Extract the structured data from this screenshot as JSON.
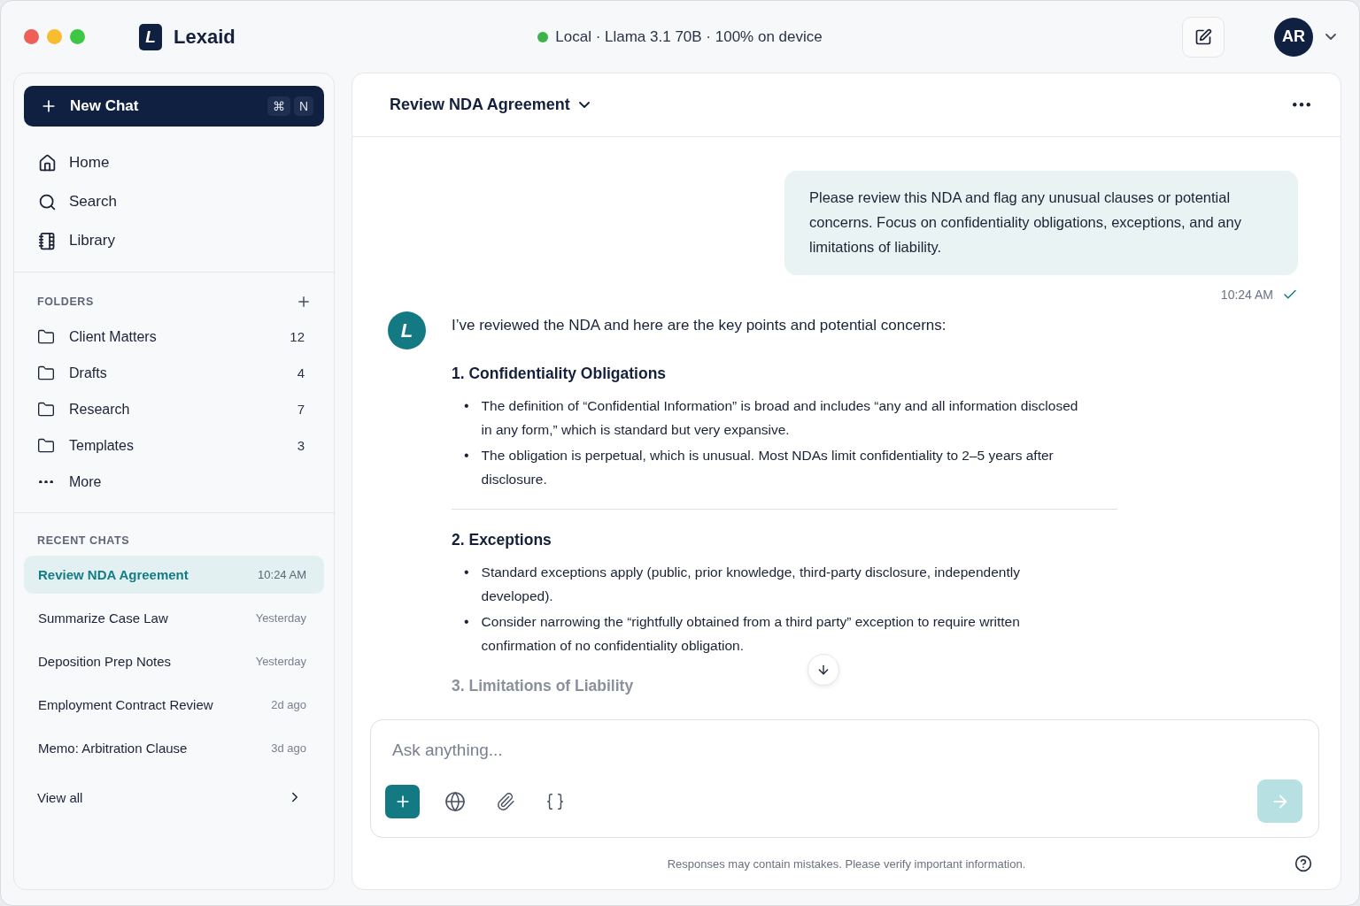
{
  "app": {
    "logo_letter": "L",
    "name": "Lexaid"
  },
  "status": {
    "online": true,
    "text": "Local · Llama 3.1 70B · 100% on device"
  },
  "user": {
    "initials": "AR"
  },
  "sidebar": {
    "new_chat": {
      "label": "New Chat",
      "keys": [
        "⌘",
        "N"
      ]
    },
    "nav": [
      {
        "kind": "home",
        "label": "Home"
      },
      {
        "kind": "search",
        "label": "Search"
      },
      {
        "kind": "library",
        "label": "Library"
      }
    ],
    "folders": {
      "title": "FOLDERS",
      "items": [
        {
          "name": "Client Matters",
          "count": "12"
        },
        {
          "name": "Drafts",
          "count": "4"
        },
        {
          "name": "Research",
          "count": "7"
        },
        {
          "name": "Templates",
          "count": "3"
        }
      ],
      "more": "More"
    },
    "recent": {
      "title": "RECENT CHATS",
      "items": [
        {
          "title": "Review NDA Agreement",
          "time": "10:24 AM",
          "selected": true
        },
        {
          "title": "Summarize Case Law",
          "time": "Yesterday",
          "selected": false
        },
        {
          "title": "Deposition Prep Notes",
          "time": "Yesterday",
          "selected": false
        },
        {
          "title": "Employment Contract Review",
          "time": "2d ago",
          "selected": false
        },
        {
          "title": "Memo: Arbitration Clause",
          "time": "3d ago",
          "selected": false
        }
      ],
      "view_all": "View all"
    }
  },
  "chat": {
    "title": "Review NDA Agreement",
    "user_message": {
      "text": "Please review this NDA and flag any unusual clauses or potential concerns. Focus on confidentiality obligations, exceptions, and any limitations of liability.",
      "time": "10:24 AM",
      "delivered": true
    },
    "reply": {
      "avatar_letter": "L",
      "intro": "I’ve reviewed the NDA and here are the key points and potential concerns:",
      "sections": [
        {
          "heading": "1. Confidentiality Obligations",
          "bullets": [
            {
              "marker": "•",
              "text": "The definition of “Confidential Information” is broad and includes “any and all information disclosed in any form,” which is standard but very expansive."
            },
            {
              "marker": "•",
              "text": "The obligation is perpetual, which is unusual. Most NDAs limit confidentiality to 2–5 years after disclosure."
            }
          ]
        },
        {
          "heading": "2. Exceptions",
          "bullets": [
            {
              "marker": "•",
              "text": "Standard exceptions apply (public, prior knowledge, third-party disclosure, independently developed)."
            },
            {
              "marker": "•",
              "text": "Consider narrowing the “rightfully obtained from a third party” exception to require written confirmation of no confidentiality obligation."
            }
          ]
        }
      ],
      "faded_heading": "3. Limitations of Liability"
    }
  },
  "composer": {
    "placeholder": "Ask anything...",
    "note": "Responses may contain mistakes. Please verify important information."
  }
}
